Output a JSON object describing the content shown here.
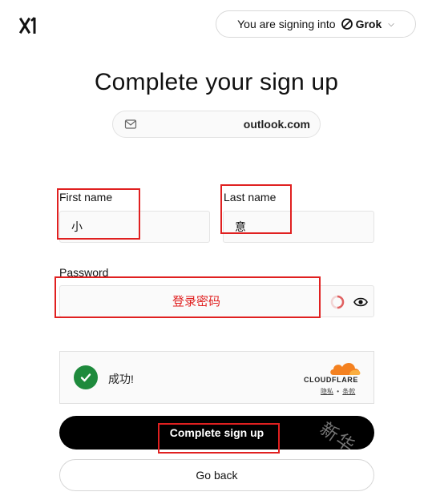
{
  "header": {
    "logo_icon": "x-ai-logo-icon",
    "signing_into_text": "You are signing into",
    "app_name": "Grok",
    "app_icon": "grok-logo-icon",
    "dropdown_icon": "chevron-down-icon"
  },
  "title": "Complete your sign up",
  "email": {
    "icon": "mail-icon",
    "value": "outlook.com"
  },
  "form": {
    "first_name_label": "First name",
    "first_name_value": "小",
    "last_name_label": "Last name",
    "last_name_value": "意",
    "password_label": "Password",
    "password_annotation": "登录密码",
    "loading_icon": "spinner-icon",
    "toggle_visibility_icon": "eye-icon"
  },
  "captcha": {
    "status_icon": "check-circle-icon",
    "status_text": "成功!",
    "brand": "CLOUDFLARE",
    "brand_icon": "cloud-icon",
    "privacy_link": "隐私",
    "separator": "•",
    "terms_link": "条款"
  },
  "buttons": {
    "complete": "Complete sign up",
    "go_back": "Go back"
  },
  "watermark": "新华",
  "colors": {
    "annotation_red": "#e02020",
    "success_green": "#1e8a3c",
    "cloudflare_orange": "#f48120",
    "primary_button": "#000000"
  }
}
